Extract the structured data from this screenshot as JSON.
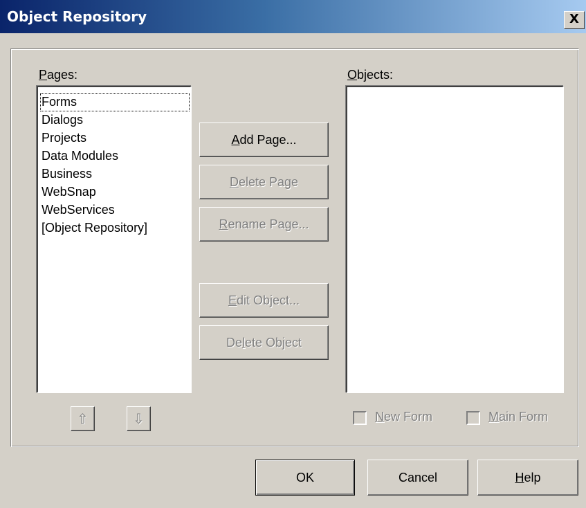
{
  "window": {
    "title": "Object Repository",
    "close_glyph": "X",
    "close_icon": "close-icon"
  },
  "pages": {
    "label": "Pages:",
    "items": [
      "Forms",
      "Dialogs",
      "Projects",
      "Data Modules",
      "Business",
      "WebSnap",
      "WebServices",
      "[Object Repository]"
    ],
    "selected_index": 0
  },
  "objects": {
    "label": "Objects:",
    "items": []
  },
  "buttons": {
    "add_page": "Add Page...",
    "delete_page": "Delete Page",
    "rename_page": "Rename Page...",
    "edit_object": "Edit Object...",
    "delete_object": "Delete Object",
    "ok": "OK",
    "cancel": "Cancel",
    "help": "Help"
  },
  "move_buttons": {
    "up_glyph": "⇧",
    "down_glyph": "⇩",
    "up_icon": "arrow-up-icon",
    "down_icon": "arrow-down-icon"
  },
  "checkboxes": {
    "new_form": {
      "label": "New Form",
      "checked": false,
      "enabled": false
    },
    "main_form": {
      "label": "Main Form",
      "checked": false,
      "enabled": false
    }
  },
  "colors": {
    "titlebar_start": "#0a246a",
    "titlebar_end": "#a6caf0",
    "face": "#d4d0c8",
    "disabled_text": "#808080"
  }
}
